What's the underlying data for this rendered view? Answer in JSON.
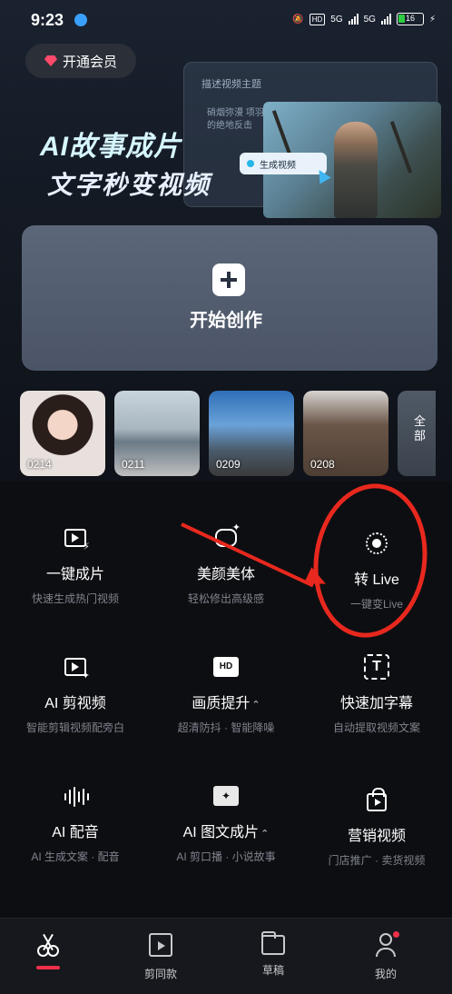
{
  "status_bar": {
    "time": "9:23",
    "network_1": "5G",
    "network_2": "5G",
    "hd_label": "HD",
    "battery": "16"
  },
  "header": {
    "vip_label": "开通会员"
  },
  "banner": {
    "title_line1": "AI故事成片",
    "title_line2": "文字秒变视频",
    "card_label": "描述视频主题",
    "card_text": "硝烟弥漫 项羽的绝地反击",
    "generate_label": "生成视频"
  },
  "create": {
    "label": "开始创作"
  },
  "recent": {
    "items": [
      {
        "date": "0214"
      },
      {
        "date": "0211"
      },
      {
        "date": "0209"
      },
      {
        "date": "0208"
      }
    ],
    "all_label": "全部"
  },
  "tools": [
    {
      "title": "一键成片",
      "subtitle": "快速生成热门视频",
      "icon": "auto-video-icon"
    },
    {
      "title": "美颜美体",
      "subtitle": "轻松修出高级感",
      "icon": "beauty-icon"
    },
    {
      "title": "转 Live",
      "subtitle": "一键变Live",
      "icon": "live-icon"
    },
    {
      "title": "AI 剪视频",
      "subtitle": "智能剪辑视频配旁白",
      "icon": "ai-edit-icon"
    },
    {
      "title": "画质提升",
      "subtitle": "超清防抖 · 智能降噪",
      "icon": "hd-icon"
    },
    {
      "title": "快速加字幕",
      "subtitle": "自动提取视频文案",
      "icon": "subtitle-icon"
    },
    {
      "title": "AI 配音",
      "subtitle": "AI 生成文案 · 配音",
      "icon": "voice-icon"
    },
    {
      "title": "AI 图文成片",
      "subtitle": "AI 剪口播 · 小说故事",
      "icon": "image-text-icon"
    },
    {
      "title": "营销视频",
      "subtitle": "门店推广 · 卖货视频",
      "icon": "marketing-icon"
    }
  ],
  "bottom_nav": [
    {
      "label": "",
      "icon": "scissors-icon",
      "active": true
    },
    {
      "label": "剪同款",
      "icon": "template-icon"
    },
    {
      "label": "草稿",
      "icon": "folder-icon"
    },
    {
      "label": "我的",
      "icon": "profile-icon"
    }
  ],
  "colors": {
    "accent": "#f0304a",
    "annotation": "#e8281e",
    "background": "#0c0d11"
  }
}
